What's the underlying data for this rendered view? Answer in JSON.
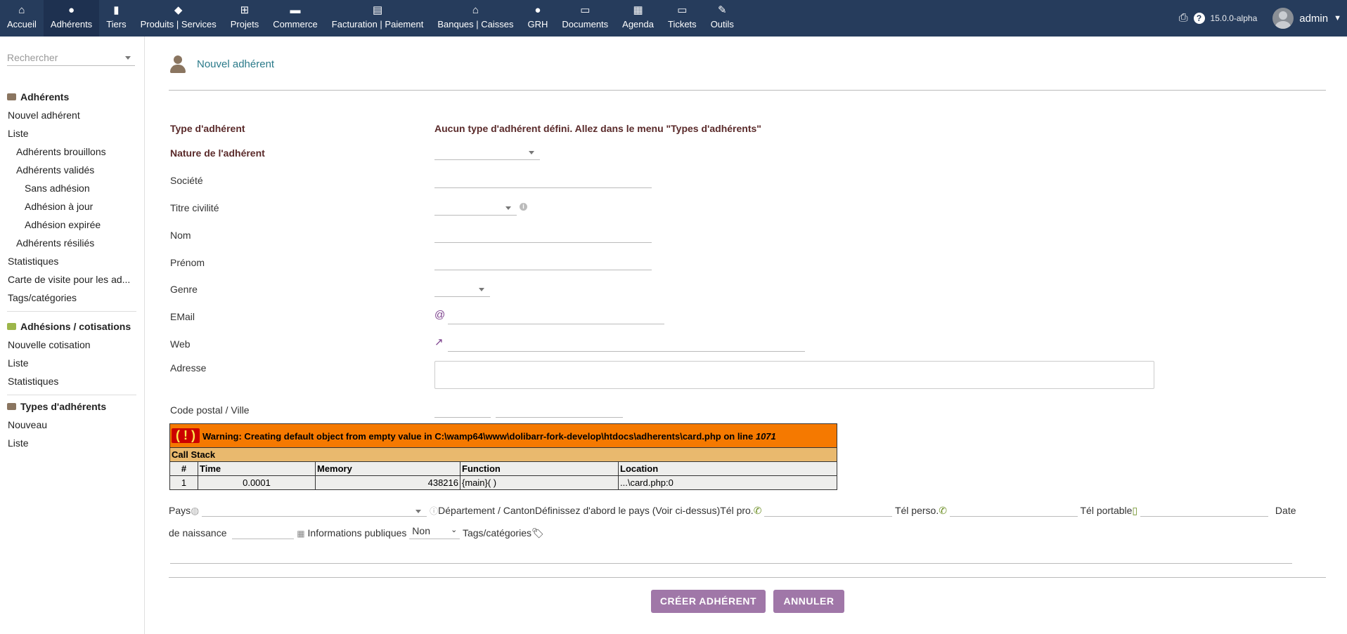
{
  "topbar": {
    "menu": [
      {
        "label": "Accueil",
        "icon": "home-icon",
        "glyph": "⌂"
      },
      {
        "label": "Adhérents",
        "icon": "user-icon",
        "glyph": "●"
      },
      {
        "label": "Tiers",
        "icon": "building-icon",
        "glyph": "▮"
      },
      {
        "label": "Produits | Services",
        "icon": "cube-icon",
        "glyph": "◆"
      },
      {
        "label": "Projets",
        "icon": "sitemap-icon",
        "glyph": "⊞"
      },
      {
        "label": "Commerce",
        "icon": "briefcase-icon",
        "glyph": "▬"
      },
      {
        "label": "Facturation | Paiement",
        "icon": "money-icon",
        "glyph": "▤"
      },
      {
        "label": "Banques | Caisses",
        "icon": "bank-icon",
        "glyph": "⌂"
      },
      {
        "label": "GRH",
        "icon": "user-tie-icon",
        "glyph": "●"
      },
      {
        "label": "Documents",
        "icon": "folder-icon",
        "glyph": "▭"
      },
      {
        "label": "Agenda",
        "icon": "calendar-icon",
        "glyph": "▦"
      },
      {
        "label": "Tickets",
        "icon": "ticket-icon",
        "glyph": "▭"
      },
      {
        "label": "Outils",
        "icon": "wrench-icon",
        "glyph": "✎"
      }
    ],
    "version": "15.0.0-alpha",
    "user": "admin"
  },
  "sidebar": {
    "search_placeholder": "Rechercher",
    "sections": [
      {
        "title": "Adhérents",
        "items": [
          {
            "label": "Nouvel adhérent",
            "level": 0
          },
          {
            "label": "Liste",
            "level": 0
          },
          {
            "label": "Adhérents brouillons",
            "level": 1
          },
          {
            "label": "Adhérents validés",
            "level": 1
          },
          {
            "label": "Sans adhésion",
            "level": 2
          },
          {
            "label": "Adhésion à jour",
            "level": 2
          },
          {
            "label": "Adhésion expirée",
            "level": 2
          },
          {
            "label": "Adhérents résiliés",
            "level": 1
          },
          {
            "label": "Statistiques",
            "level": 0
          },
          {
            "label": "Carte de visite pour les ad...",
            "level": 0
          },
          {
            "label": "Tags/catégories",
            "level": 0
          }
        ]
      },
      {
        "title": "Adhésions / cotisations",
        "items": [
          {
            "label": "Nouvelle cotisation",
            "level": 0
          },
          {
            "label": "Liste",
            "level": 0
          },
          {
            "label": "Statistiques",
            "level": 0
          }
        ]
      },
      {
        "title": "Types d'adhérents",
        "items": [
          {
            "label": "Nouveau",
            "level": 0
          },
          {
            "label": "Liste",
            "level": 0
          }
        ]
      }
    ]
  },
  "page": {
    "title": "Nouvel adhérent",
    "labels": {
      "type": "Type d'adhérent",
      "nature": "Nature de l'adhérent",
      "societe": "Société",
      "civilite": "Titre civilité",
      "nom": "Nom",
      "prenom": "Prénom",
      "genre": "Genre",
      "email": "EMail",
      "web": "Web",
      "adresse": "Adresse",
      "cp_ville": "Code postal / Ville"
    },
    "type_warning": "Aucun type d'adhérent défini. Allez dans le menu \"Types d'adhérents\"",
    "email_prefix": "@"
  },
  "xdebug": {
    "warning": "Warning: Creating default object from empty value in C:\\wamp64\\www\\dolibarr-fork-develop\\htdocs\\adherents\\card.php on line",
    "line": "1071",
    "bang": "( ! )",
    "call_stack": "Call Stack",
    "headers": [
      "#",
      "Time",
      "Memory",
      "Function",
      "Location"
    ],
    "rows": [
      [
        "1",
        "0.0001",
        "438216",
        "{main}( )",
        "...\\card.php:0"
      ]
    ]
  },
  "inline": {
    "pays": "Pays",
    "departement": "Département / Canton",
    "dep_hint": "Définissez d'abord le pays (Voir ci-dessus)",
    "tel_pro": "Tél pro.",
    "tel_perso": "Tél perso.",
    "tel_portable": "Tél portable",
    "date": "Date",
    "naissance": "de naissance",
    "infos_publiques": "Informations publiques",
    "public_value": "Non",
    "tags": "Tags/catégories"
  },
  "buttons": {
    "create": "CRÉER ADHÉRENT",
    "cancel": "ANNULER"
  }
}
